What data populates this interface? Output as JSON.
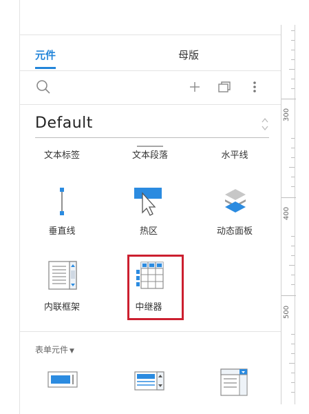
{
  "tabs": {
    "active": "元件",
    "inactive": "母版"
  },
  "toolbar": {
    "search_icon": "search-icon",
    "add_icon": "plus-icon",
    "library_icon": "stack-icon",
    "more_icon": "more-vertical-icon"
  },
  "library": {
    "selected": "Default"
  },
  "widgets": {
    "text_label": "文本标签",
    "text_paragraph": "文本段落",
    "horizontal_line": "水平线",
    "vertical_line": "垂直线",
    "hotspot": "热区",
    "dynamic_panel": "动态面板",
    "inline_frame": "内联框架",
    "repeater": "中继器"
  },
  "form_section": {
    "title": "表单元件"
  },
  "ruler": {
    "labels": [
      "300",
      "400",
      "500"
    ]
  },
  "colors": {
    "accent": "#2385d9",
    "highlight": "#cc1f2f"
  }
}
